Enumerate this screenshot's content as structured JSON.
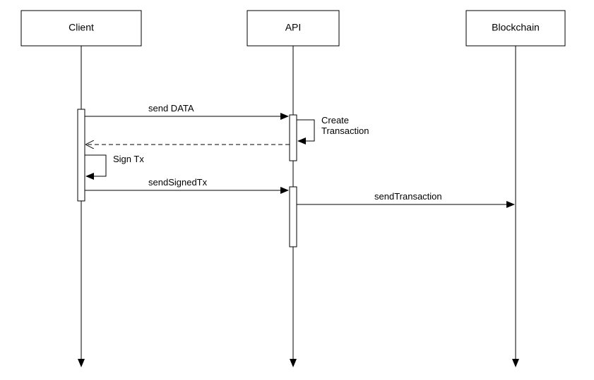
{
  "chart_data": {
    "type": "sequence-diagram",
    "participants": [
      "Client",
      "API",
      "Blockchain"
    ],
    "messages": [
      {
        "from": "Client",
        "to": "API",
        "label": "send DATA",
        "style": "solid"
      },
      {
        "from": "API",
        "to": "API",
        "label": "Create Transaction",
        "style": "self"
      },
      {
        "from": "API",
        "to": "Client",
        "label": "",
        "style": "dashed"
      },
      {
        "from": "Client",
        "to": "Client",
        "label": "Sign Tx",
        "style": "self"
      },
      {
        "from": "Client",
        "to": "API",
        "label": "sendSignedTx",
        "style": "solid"
      },
      {
        "from": "API",
        "to": "Blockchain",
        "label": "sendTransaction",
        "style": "solid"
      }
    ]
  },
  "participants": {
    "client": "Client",
    "api": "API",
    "blockchain": "Blockchain"
  },
  "messages": {
    "sendData": "send DATA",
    "createTx1": "Create",
    "createTx2": "Transaction",
    "signTx": "Sign Tx",
    "sendSignedTx": "sendSignedTx",
    "sendTransaction": "sendTransaction"
  }
}
